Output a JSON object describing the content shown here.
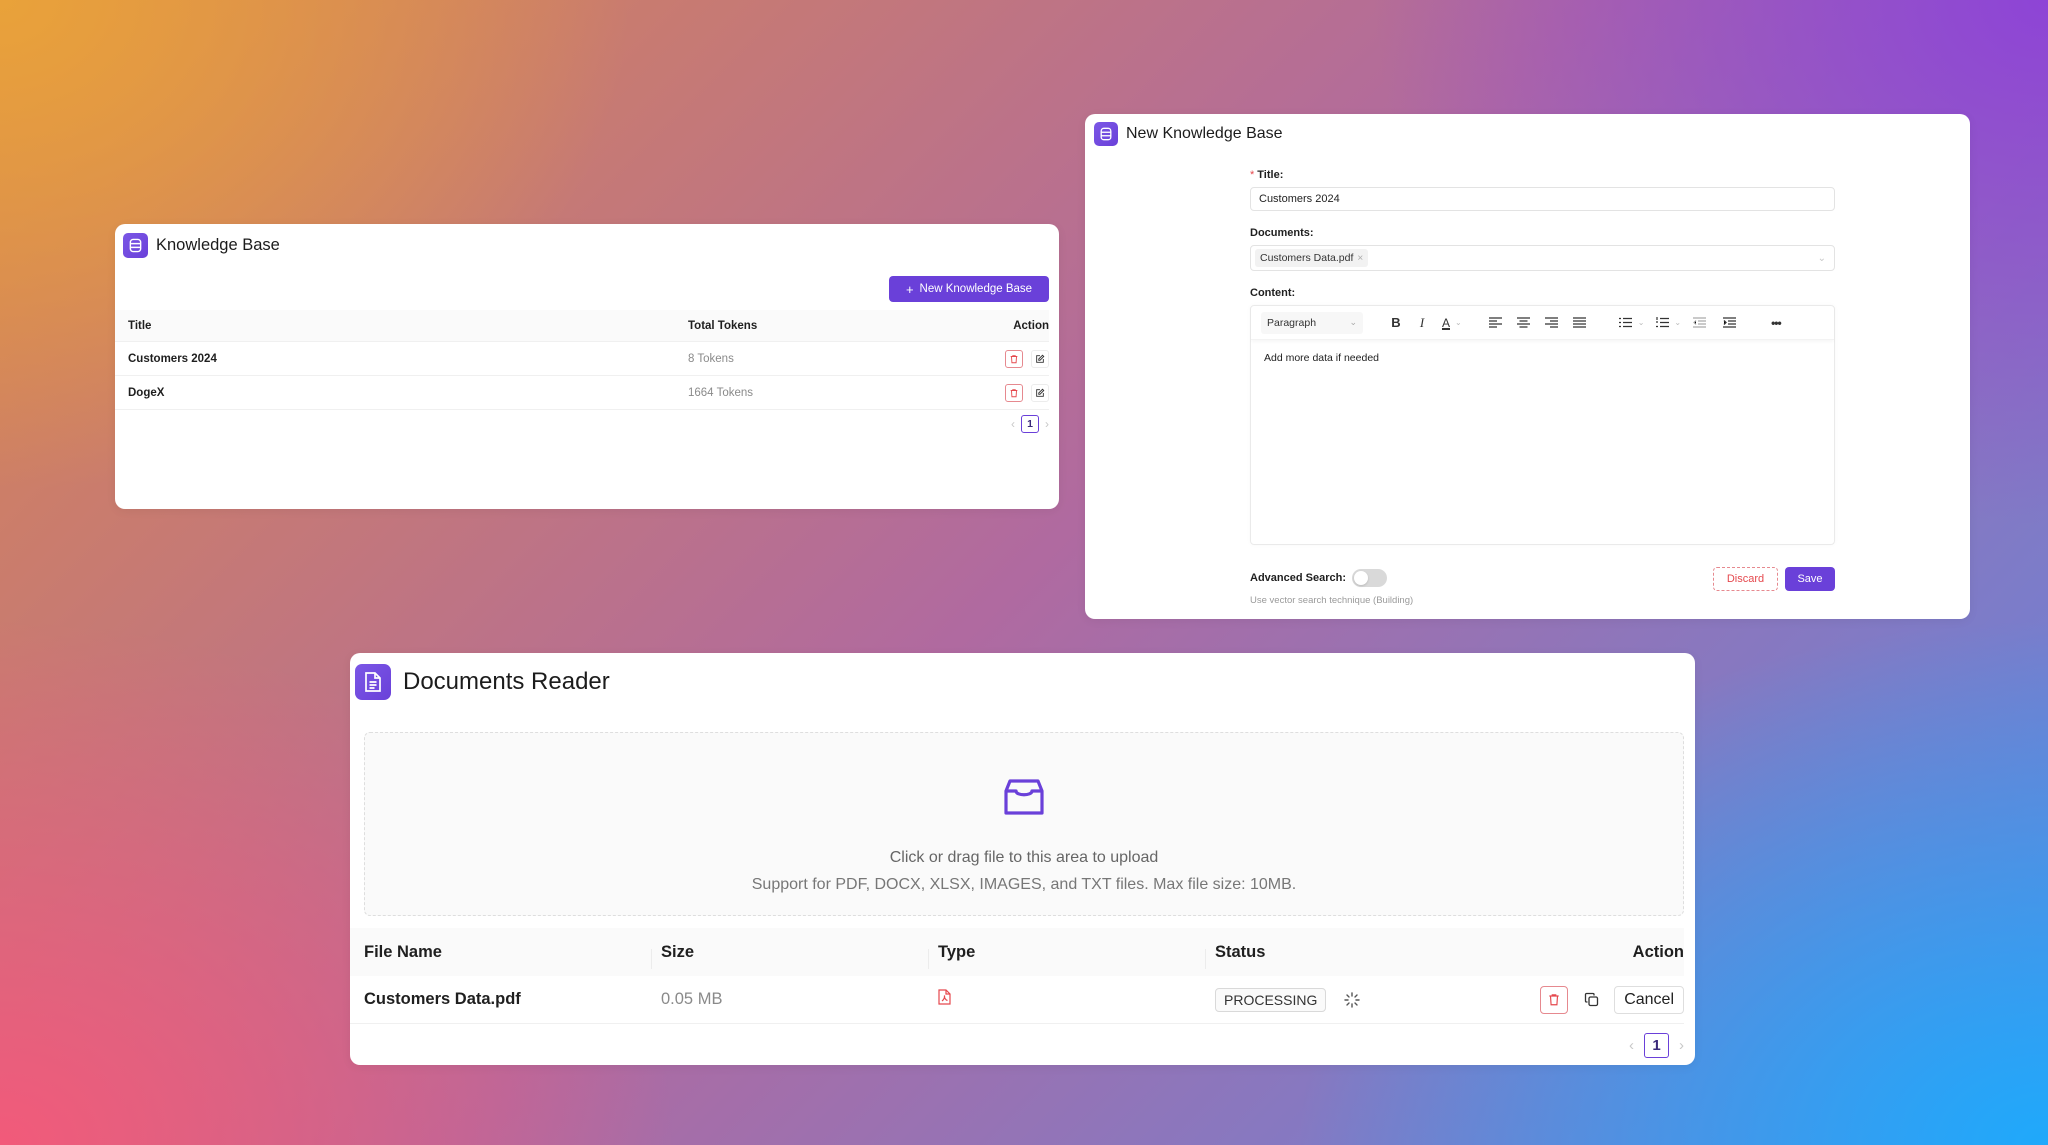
{
  "colors": {
    "accent": "#6a40d9",
    "danger": "#e5484d",
    "muted": "#8a8a8a"
  },
  "knowledge_base": {
    "title": "Knowledge Base",
    "logo_icon": "database-icon",
    "new_button_label": "New Knowledge Base",
    "columns": [
      "Title",
      "Total Tokens",
      "Action"
    ],
    "rows": [
      {
        "title": "Customers 2024",
        "tokens": "8 Tokens"
      },
      {
        "title": "DogeX",
        "tokens": "1664 Tokens"
      }
    ],
    "pagination": {
      "prev": "‹",
      "current": "1",
      "next": "›"
    }
  },
  "new_knowledge_base": {
    "title": "New Knowledge Base",
    "logo_icon": "database-icon",
    "title_field": {
      "required_mark": "*",
      "label": "Title:",
      "value": "Customers 2024"
    },
    "documents_field": {
      "label": "Documents:",
      "selected": [
        "Customers Data.pdf"
      ],
      "remove_glyph": "×"
    },
    "content_field": {
      "label": "Content:",
      "toolbar": {
        "block_format": "Paragraph",
        "bold": "B",
        "italic": "I",
        "text_color": "A",
        "more": "•••"
      },
      "value": "Add more data if needed"
    },
    "advanced_search": {
      "label": "Advanced Search",
      "colon": ":",
      "enabled": false,
      "help": "Use vector search technique (Building)"
    },
    "discard_label": "Discard",
    "save_label": "Save"
  },
  "documents_reader": {
    "title": "Documents Reader",
    "logo_icon": "document-icon",
    "dropzone": {
      "icon": "inbox-icon",
      "primary_text": "Click or drag file to this area to upload",
      "secondary_text": "Support for PDF, DOCX, XLSX, IMAGES, and TXT files. Max file size: 10MB."
    },
    "columns": [
      "File Name",
      "Size",
      "Type",
      "Status",
      "Action"
    ],
    "rows": [
      {
        "file_name": "Customers Data.pdf",
        "size": "0.05 MB",
        "type": "pdf",
        "status": "PROCESSING",
        "cancel_label": "Cancel"
      }
    ],
    "pagination": {
      "prev": "‹",
      "current": "1",
      "next": "›"
    }
  }
}
